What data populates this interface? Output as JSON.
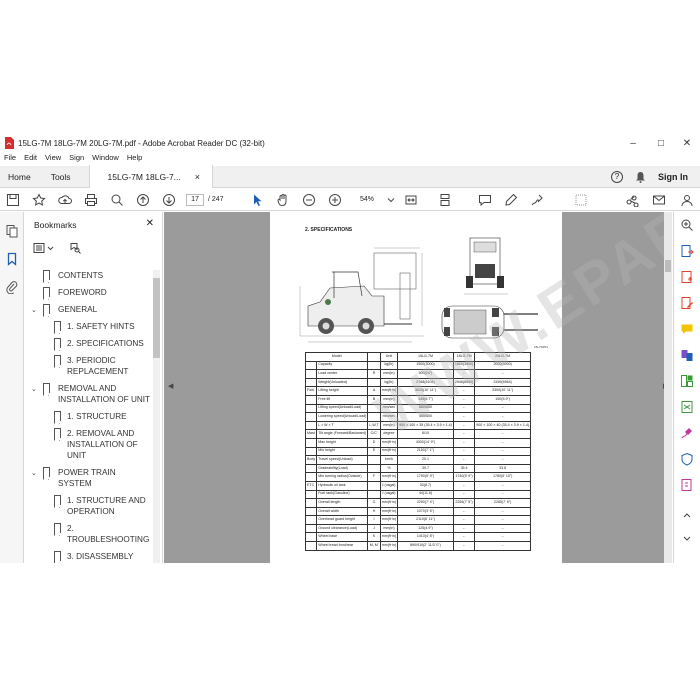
{
  "window": {
    "title": "15LG-7M 18LG-7M 20LG-7M.pdf - Adobe Acrobat Reader DC (32-bit)",
    "minimize": "–",
    "maximize": "□",
    "close": "✕"
  },
  "menu": [
    "File",
    "Edit",
    "View",
    "Sign",
    "Window",
    "Help"
  ],
  "tabs": {
    "home": "Home",
    "tools": "Tools",
    "document": "15LG-7M 18LG-7...",
    "close": "×",
    "help": "?",
    "sign_in": "Sign In"
  },
  "toolbar": {
    "page_current": "17",
    "page_total": "/ 247",
    "zoom": "54%"
  },
  "bookmarks": {
    "header": "Bookmarks",
    "close": "✕",
    "items": [
      {
        "label": "CONTENTS",
        "level": 1,
        "caret": ""
      },
      {
        "label": "FOREWORD",
        "level": 1,
        "caret": ""
      },
      {
        "label": "GENERAL",
        "level": 1,
        "caret": "⌄"
      },
      {
        "label": "1. SAFETY HINTS",
        "level": 2,
        "caret": ""
      },
      {
        "label": "2. SPECIFICATIONS",
        "level": 2,
        "caret": ""
      },
      {
        "label": "3. PERIODIC REPLACEMENT",
        "level": 2,
        "caret": ""
      },
      {
        "label": "REMOVAL AND INSTALLATION OF UNIT",
        "level": 1,
        "caret": "⌄"
      },
      {
        "label": "1. STRUCTURE",
        "level": 2,
        "caret": ""
      },
      {
        "label": "2. REMOVAL AND INSTALLATION OF UNIT",
        "level": 2,
        "caret": ""
      },
      {
        "label": "POWER TRAIN SYSTEM",
        "level": 1,
        "caret": "⌄"
      },
      {
        "label": "1. STRUCTURE AND OPERATION",
        "level": 2,
        "caret": ""
      },
      {
        "label": "2. TROUBLESHOOTING",
        "level": 2,
        "caret": ""
      },
      {
        "label": "3. DISASSEMBLY",
        "level": 2,
        "caret": ""
      }
    ]
  },
  "page": {
    "section_title": "2. SPECIFICATIONS",
    "drawing_code": "15L7SP01",
    "watermark": "WWW.EPARTS.COM",
    "table_headers": [
      "Model",
      "",
      "Unit",
      "15LG-7M",
      "18LG-7M",
      "20LG-7M"
    ],
    "rows": [
      {
        "group": "",
        "item": "Capacity",
        "code": "",
        "unit": "kg(lb)",
        "a": "1500(3000)",
        "b": "1800(3500)",
        "c": "2000(4000)"
      },
      {
        "group": "",
        "item": "Load center",
        "code": "R",
        "unit": "mm(in)",
        "a": "500(24\")",
        "b": "←",
        "c": "←"
      },
      {
        "group": "",
        "item": "Weight(Unloaded)",
        "code": "",
        "unit": "kg(lb)",
        "a": "2768(6104)",
        "b": "2946(6500)",
        "c": "3159(6964)"
      },
      {
        "group": "Fork",
        "item": "Lifting height",
        "code": "A",
        "unit": "mm(ft·in)",
        "a": "3025(10' 11\")",
        "b": "←",
        "c": "3300(10' 11\")"
      },
      {
        "group": "",
        "item": "Free lift",
        "code": "B",
        "unit": "mm(in)",
        "a": "145(5.7\")",
        "b": "←",
        "c": "150(5.9\")"
      },
      {
        "group": "",
        "item": "Lifting speed(Unload/Load)",
        "code": "",
        "unit": "mm/sec",
        "a": "680/650",
        "b": "←",
        "c": "←"
      },
      {
        "group": "",
        "item": "Lowering speed(Unload/Load)",
        "code": "",
        "unit": "mm/sec",
        "a": "450/500",
        "b": "←",
        "c": "←"
      },
      {
        "group": "",
        "item": "L × W × T",
        "code": "L,W,T",
        "unit": "mm(in)",
        "a": "900 × 100 × 35 (35.4 × 3.9 × 1.4)",
        "b": "←",
        "c": "900 × 100 × 40 (35.4 × 3.9 × 1.4)"
      },
      {
        "group": "Mast",
        "item": "Tilt angle (Forward/Backward)",
        "code": "C/C'",
        "unit": "degree",
        "a": "6/10",
        "b": "←",
        "c": "←"
      },
      {
        "group": "",
        "item": "Max height",
        "code": "D",
        "unit": "mm(ft·in)",
        "a": "4300(14' 9\")",
        "b": "←",
        "c": "←"
      },
      {
        "group": "",
        "item": "Min height",
        "code": "E",
        "unit": "mm(ft·in)",
        "a": "2150(7' 1\")",
        "b": "←",
        "c": "←"
      },
      {
        "group": "Body",
        "item": "Travel speed(Unload)",
        "code": "",
        "unit": "km/h",
        "a": "20.1",
        "b": "←",
        "c": "←"
      },
      {
        "group": "",
        "item": "Gradeability(Load)",
        "code": "",
        "unit": "%",
        "a": "39.7",
        "b": "35.4",
        "c": "33.8"
      },
      {
        "group": "",
        "item": "Min turning radius(Outside)",
        "code": "F",
        "unit": "mm(ft·in)",
        "a": "1750(5' 9\")",
        "b": "1740(5' 9\")",
        "c": "1780(5' 10\")"
      },
      {
        "group": "ETC",
        "item": "Hydraulic oil tank",
        "code": "",
        "unit": "ℓ (usgal)",
        "a": "30(8.7)",
        "b": "←",
        "c": "←"
      },
      {
        "group": "",
        "item": "Fuel tank(Gasoline)",
        "code": "",
        "unit": "ℓ (usgal)",
        "a": "44(11.6)",
        "b": "←",
        "c": "←"
      },
      {
        "group": "",
        "item": "Overall length",
        "code": "G",
        "unit": "mm(ft·in)",
        "a": "2250(7' 4\")",
        "b": "2265(7' 5\")",
        "c": "2285(7' 6\")"
      },
      {
        "group": "",
        "item": "Overall width",
        "code": "H",
        "unit": "mm(ft·in)",
        "a": "1070(3' 6\")",
        "b": "←",
        "c": "←"
      },
      {
        "group": "",
        "item": "Overhead guard height",
        "code": "I",
        "unit": "mm(ft·in)",
        "a": "2110(6' 11\")",
        "b": "←",
        "c": "←"
      },
      {
        "group": "",
        "item": "Ground clearance(Load)",
        "code": "J",
        "unit": "mm(in)",
        "a": "125(4.9\")",
        "b": "←",
        "c": "←"
      },
      {
        "group": "",
        "item": "Wheel base",
        "code": "K",
        "unit": "mm(ft·in)",
        "a": "1410(4' 8\")",
        "b": "←",
        "c": "←"
      },
      {
        "group": "",
        "item": "Wheel tread front/rear",
        "code": "M, M'",
        "unit": "mm(ft·in)",
        "a": "890/910(2' 11/3' 0\")",
        "b": "←",
        "c": "←"
      }
    ]
  },
  "colors": {
    "accent_red": "#d32f2f",
    "rail_blue": "#1f5fb4",
    "doc_bg": "#9b9b9b"
  }
}
